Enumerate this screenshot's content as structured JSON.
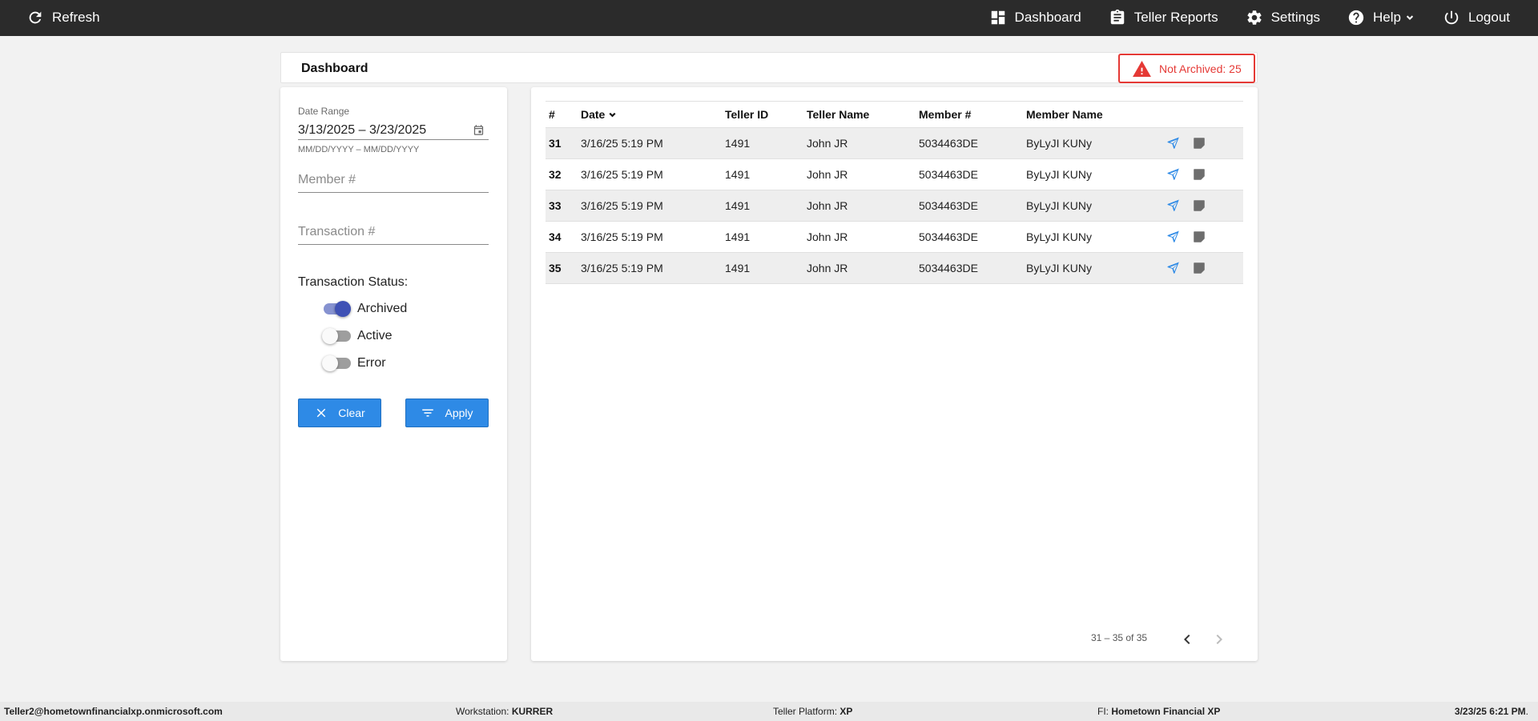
{
  "topbar": {
    "refresh_label": "Refresh",
    "nav": [
      {
        "label": "Dashboard",
        "icon": "dashboard-icon"
      },
      {
        "label": "Teller Reports",
        "icon": "clipboard-icon"
      },
      {
        "label": "Settings",
        "icon": "gear-icon"
      },
      {
        "label": "Help",
        "icon": "help-icon"
      },
      {
        "label": "Logout",
        "icon": "power-icon"
      }
    ]
  },
  "header": {
    "title": "Dashboard",
    "not_archived_label": "Not Archived: 25",
    "alert_color": "#e53935"
  },
  "filters": {
    "date_range_label": "Date Range",
    "date_range_value": "3/13/2025 – 3/23/2025",
    "date_hint": "MM/DD/YYYY – MM/DD/YYYY",
    "member_placeholder": "Member #",
    "transaction_placeholder": "Transaction #",
    "status_label": "Transaction Status:",
    "statuses": [
      {
        "label": "Archived",
        "on": true
      },
      {
        "label": "Active",
        "on": false
      },
      {
        "label": "Error",
        "on": false
      }
    ],
    "clear_label": "Clear",
    "apply_label": "Apply",
    "button_color": "#2e8ae6"
  },
  "table": {
    "columns": [
      "#",
      "Date",
      "Teller ID",
      "Teller Name",
      "Member #",
      "Member Name"
    ],
    "rows": [
      {
        "num": "31",
        "date": "3/16/25 5:19 PM",
        "teller_id": "1491",
        "teller_name": "John JR",
        "member_num": "5034463DE",
        "member_name": "ByLyJI KUNy"
      },
      {
        "num": "32",
        "date": "3/16/25 5:19 PM",
        "teller_id": "1491",
        "teller_name": "John JR",
        "member_num": "5034463DE",
        "member_name": "ByLyJI KUNy"
      },
      {
        "num": "33",
        "date": "3/16/25 5:19 PM",
        "teller_id": "1491",
        "teller_name": "John JR",
        "member_num": "5034463DE",
        "member_name": "ByLyJI KUNy"
      },
      {
        "num": "34",
        "date": "3/16/25 5:19 PM",
        "teller_id": "1491",
        "teller_name": "John JR",
        "member_num": "5034463DE",
        "member_name": "ByLyJI KUNy"
      },
      {
        "num": "35",
        "date": "3/16/25 5:19 PM",
        "teller_id": "1491",
        "teller_name": "John JR",
        "member_num": "5034463DE",
        "member_name": "ByLyJI KUNy"
      }
    ],
    "send_icon_color": "#2e8ae6",
    "note_icon_color": "#6d6d6d"
  },
  "pagination": {
    "range_label": "31 – 35 of 35"
  },
  "footer": {
    "user": "Teller2@hometownfinancialxp.onmicrosoft.com",
    "workstation_label": "Workstation:",
    "workstation_value": "KURRER",
    "platform_label": "Teller Platform:",
    "platform_value": "XP",
    "fi_label": "FI:",
    "fi_value": "Hometown Financial XP",
    "datetime": "3/23/25 6:21 PM",
    "datetime_suffix": "."
  }
}
